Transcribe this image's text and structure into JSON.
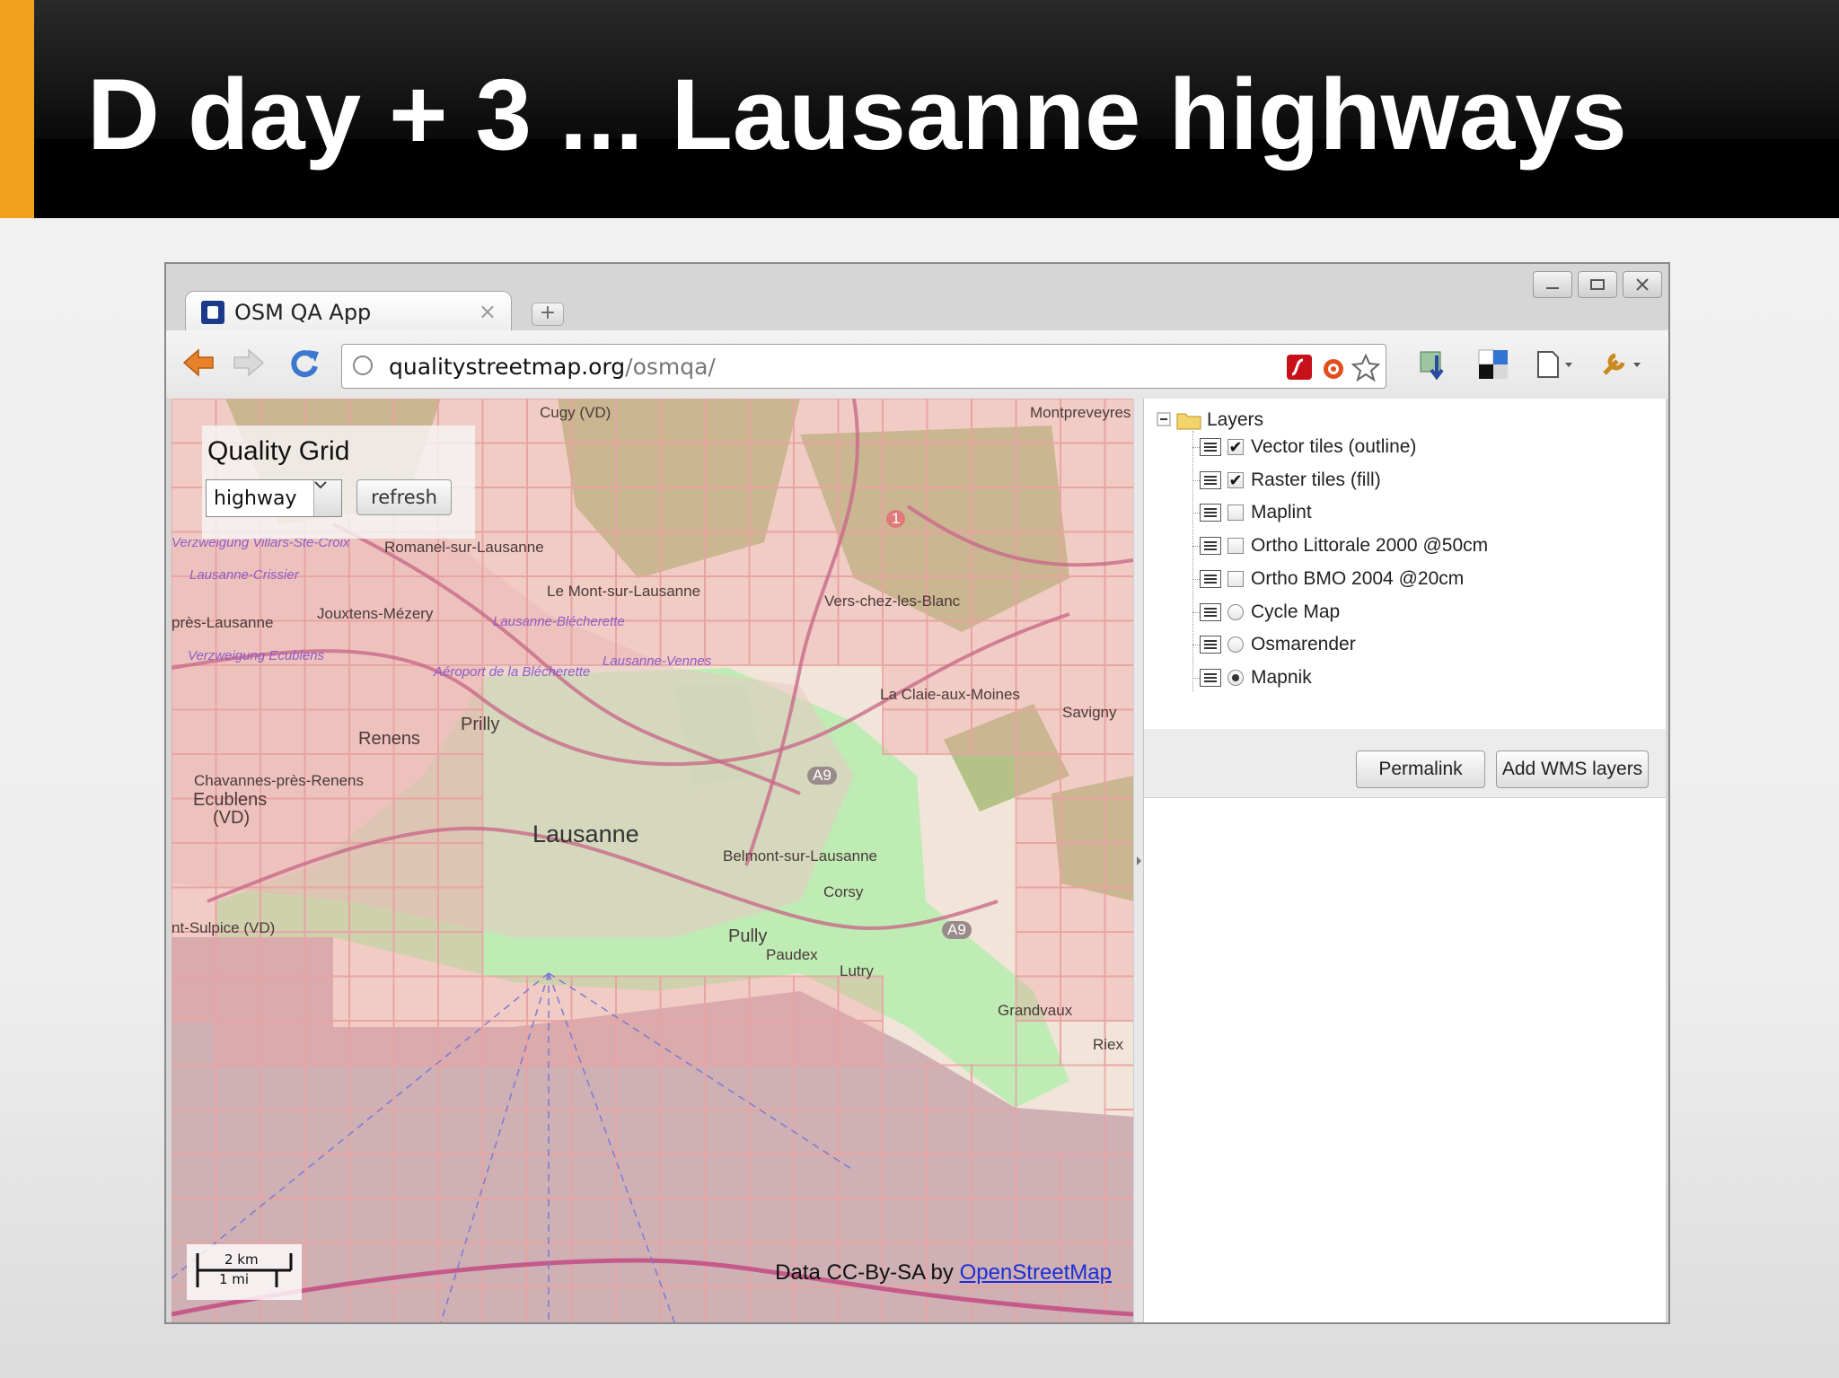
{
  "slide": {
    "title": "D day + 3 ... Lausanne highways"
  },
  "browser": {
    "tab_title": "OSM QA App",
    "tab_close": "×",
    "new_tab": "+",
    "url_host": "qualitystreetmap.org",
    "url_path": "/osmqa/"
  },
  "map": {
    "quality_grid": {
      "title": "Quality Grid",
      "select_value": "highway",
      "refresh_label": "refresh"
    },
    "labels": {
      "cugy": "Cugy (VD)",
      "montpreveyres": "Montpreveyres",
      "romanel": "Romanel-sur-Lausanne",
      "mont": "Le Mont-sur-Lausanne",
      "vers_chez": "Vers-chez-les-Blanc",
      "jouxtens": "Jouxtens-Mézery",
      "pres_lausanne": "près-Lausanne",
      "claie": "La Claie-aux-Moines",
      "savigny": "Savigny",
      "renens": "Renens",
      "prilly": "Prilly",
      "chavannes": "Chavannes-près-Renens",
      "ecublens": "Ecublens",
      "ecublens2": "(VD)",
      "lausanne": "Lausanne",
      "belmont": "Belmont-sur-Lausanne",
      "corsy": "Corsy",
      "pully": "Pully",
      "paudex": "Paudex",
      "lutry": "Lutry",
      "sulpice": "nt-Sulpice (VD)",
      "grandvaux": "Grandvaux",
      "riex": "Riex",
      "crissier": "Lausanne-Crissier",
      "blecherette": "Lausanne-Blécherette",
      "vennes": "Lausanne-Vennes",
      "verzweigung": "Verzweigung Ecublens",
      "aeroport": "Aéroport de la Blécherette",
      "villars": "Verzweigung Villars-Ste-Croix",
      "route_a9": "A9",
      "route_a9b": "A9",
      "route_1": "1"
    },
    "scale_km": "2 km",
    "scale_mi": "1 mi",
    "attribution_prefix": "Data CC-By-SA by ",
    "attribution_link": "OpenStreetMap"
  },
  "layers": {
    "root": "Layers",
    "items": [
      {
        "label": "Vector tiles (outline)",
        "type": "checkbox",
        "checked": true,
        "mark": "✔"
      },
      {
        "label": "Raster tiles (fill)",
        "type": "checkbox",
        "checked": true,
        "mark": "✔"
      },
      {
        "label": "Maplint",
        "type": "checkbox",
        "checked": false,
        "mark": ""
      },
      {
        "label": "Ortho Littorale 2000 @50cm",
        "type": "checkbox",
        "checked": false,
        "mark": ""
      },
      {
        "label": "Ortho BMO 2004 @20cm",
        "type": "checkbox",
        "checked": false,
        "mark": ""
      },
      {
        "label": "Cycle Map",
        "type": "radio",
        "checked": false
      },
      {
        "label": "Osmarender",
        "type": "radio",
        "checked": false
      },
      {
        "label": "Mapnik",
        "type": "radio",
        "checked": true
      }
    ],
    "permalink_label": "Permalink",
    "add_wms_label": "Add WMS layers"
  },
  "colors": {
    "grid_red": "#e9a2a2",
    "good_green": "#b8ecb0",
    "lake_purple": "#cfb0b4",
    "slide_accent": "#f0a11e"
  }
}
